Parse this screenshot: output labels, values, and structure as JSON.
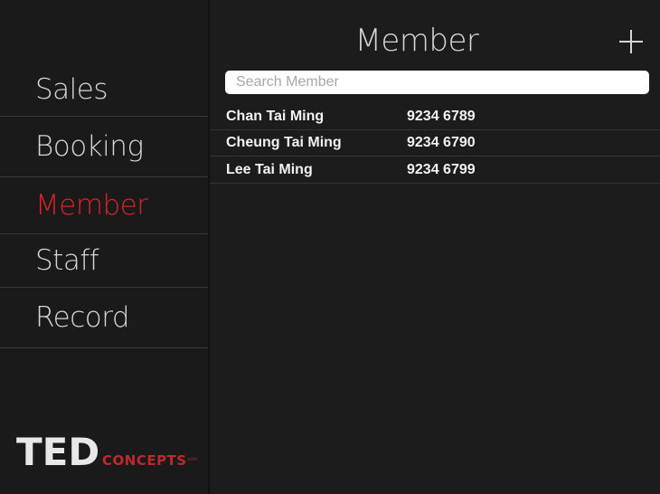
{
  "sidebar": {
    "items": [
      {
        "id": "sales",
        "label": "Sales",
        "active": false
      },
      {
        "id": "booking",
        "label": "Booking",
        "active": false
      },
      {
        "id": "member",
        "label": "Member",
        "active": true
      },
      {
        "id": "staff",
        "label": "Staff",
        "active": false
      },
      {
        "id": "record",
        "label": "Record",
        "active": false
      }
    ],
    "logo": {
      "primary": "TED",
      "secondary": "CONCEPTS",
      "suffix": ".com"
    }
  },
  "header": {
    "title": "Member",
    "add_icon": "plus-icon"
  },
  "search": {
    "placeholder": "Search Member",
    "value": ""
  },
  "members": [
    {
      "name": "Chan Tai Ming",
      "phone": "9234 6789"
    },
    {
      "name": "Cheung Tai Ming",
      "phone": "9234 6790"
    },
    {
      "name": "Lee Tai Ming",
      "phone": "9234 6799"
    }
  ],
  "colors": {
    "background": "#1c1c1c",
    "sidebar_text": "#d6d6d6",
    "active": "#d9232a",
    "brand_red": "#c0272d"
  }
}
